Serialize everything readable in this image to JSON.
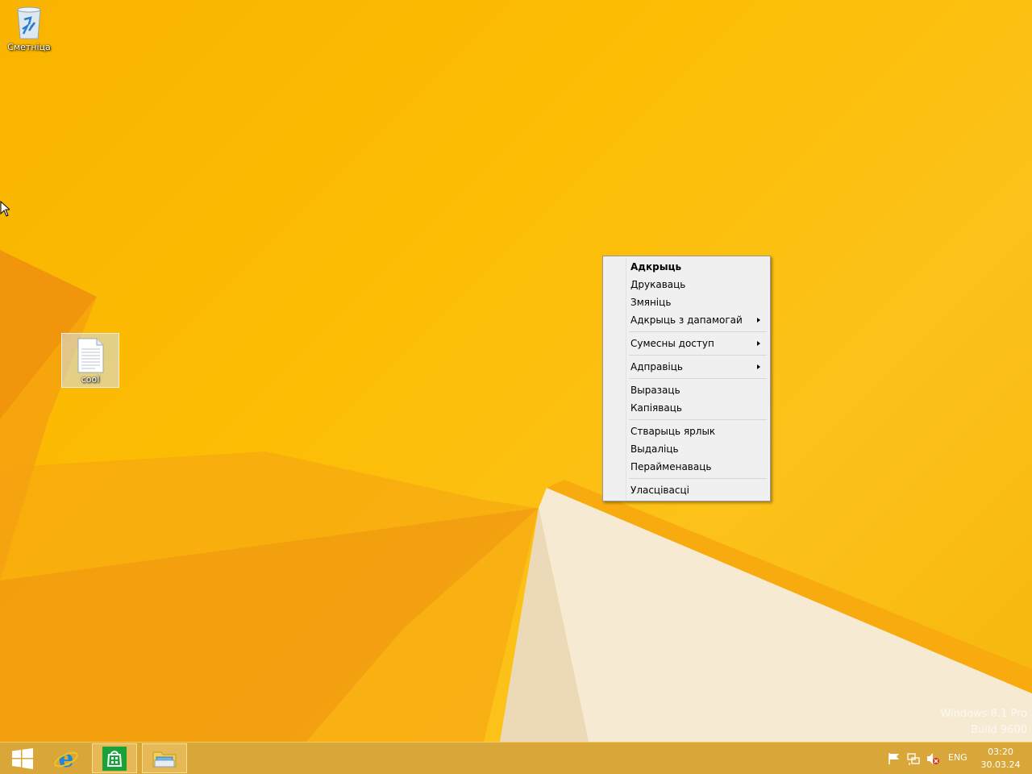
{
  "desktop": {
    "icons": [
      {
        "label": "Сметніца",
        "icon": "recycle-bin-icon"
      },
      {
        "label": "cool",
        "icon": "text-file-icon"
      }
    ]
  },
  "context_menu": {
    "items": [
      {
        "label": "Адкрыць",
        "bold": true
      },
      {
        "label": "Друкаваць"
      },
      {
        "label": "Змяніць"
      },
      {
        "label": "Адкрыць з дапамогай",
        "submenu": true
      },
      {
        "label": "Сумесны доступ",
        "submenu": true
      },
      {
        "label": "Адправіць",
        "submenu": true
      },
      {
        "label": "Выразаць"
      },
      {
        "label": "Капіяваць"
      },
      {
        "label": "Стварыць ярлык"
      },
      {
        "label": "Выдаліць"
      },
      {
        "label": "Перайменаваць"
      },
      {
        "label": "Уласцівасці"
      }
    ]
  },
  "watermark": {
    "line1": "Windows 8.1 Pro",
    "line2": "Build 9600"
  },
  "taskbar": {
    "pinned": [
      "windows-start-icon",
      "internet-explorer-icon",
      "store-icon",
      "file-explorer-icon"
    ],
    "tray": {
      "language": "ENG",
      "time": "03:20",
      "date": "30.03.24"
    }
  },
  "colors": {
    "wallpaper": "#fcbf12",
    "taskbar": "#d6a028",
    "menu_bg": "#f0f0f0"
  }
}
